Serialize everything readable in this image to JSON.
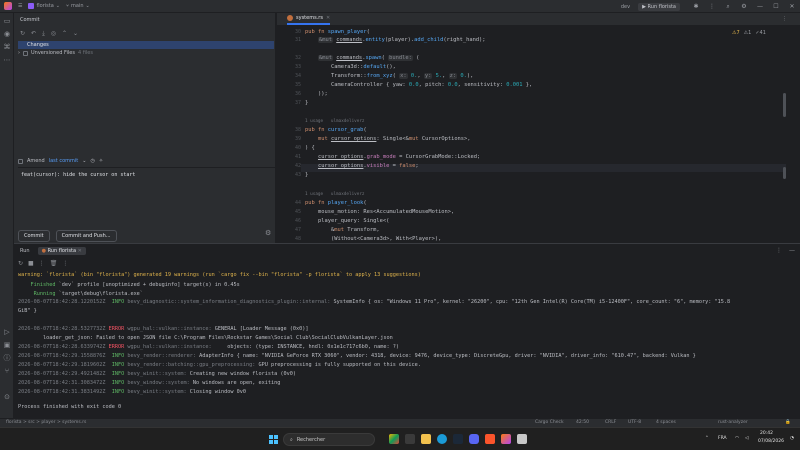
{
  "titlebar": {
    "project": "florista",
    "branch": "main",
    "run_config": "Run florista",
    "config_label": "dev"
  },
  "commit_panel": {
    "title": "Commit",
    "changes_label": "Changes",
    "unversioned_label": "Unversioned Files",
    "unversioned_count": "4 files",
    "amend_label": "Amend",
    "last_commit_link": "last commit",
    "message": "feat(cursor): hide the cursor on start",
    "commit_button": "Commit",
    "commit_push_button": "Commit and Push..."
  },
  "editor": {
    "tab_name": "systems.rs",
    "warnings": "7",
    "weak_warnings": "1",
    "hints": "41",
    "usage_1": "1 usage",
    "author_1": "ulmaxdeliverz",
    "usage_2": "1 usage",
    "author_2": "ulmaxdeliverz",
    "line_numbers": [
      "30",
      "31",
      "32",
      "33",
      "34",
      "35",
      "36",
      "37",
      "38",
      "39",
      "40",
      "41",
      "42",
      "43",
      "44",
      "45",
      "46",
      "47",
      "48"
    ]
  },
  "run_panel": {
    "tab_run": "Run",
    "tab_config": "Run florista",
    "lines": [
      {
        "kind": "warning",
        "text": "warning: `florista` (bin \"florista\") generated 19 warnings (run `cargo fix --bin \"florista\" -p florista` to apply 13 suggestions)"
      },
      {
        "kind": "finished",
        "label": "    Finished",
        "text": " `dev` profile [unoptimized + debuginfo] target(s) in 0.45s"
      },
      {
        "kind": "finished",
        "label": "     Running",
        "text": " `target\\debug\\florista.exe`"
      },
      {
        "kind": "info",
        "ts": "2026-08-07T18:42:28.1220152Z",
        "level": "  INFO",
        "mod": " bevy_diagnostic::system_information_diagnostics_plugin::internal:",
        "text": " SystemInfo { os: \"Windows 11 Pro\", kernel: \"26200\", cpu: \"12th Gen Intel(R) Core(TM) i5-12400F\", core_count: \"6\", memory: \"15.8"
      },
      {
        "kind": "plain",
        "text": "GiB\" }"
      },
      {
        "kind": "error",
        "ts": "2026-08-07T18:42:28.5327732Z",
        "level": " ERROR",
        "mod": " wgpu_hal::vulkan::instance:",
        "text": " GENERAL [Loader Message (0x0)]"
      },
      {
        "kind": "plain",
        "text": "        loader_get_json: Failed to open JSON file C:\\Program Files\\Rockstar Games\\Social Club\\SocialClubVulkanLayer.json"
      },
      {
        "kind": "error",
        "ts": "2026-08-07T18:42:28.6339742Z",
        "level": " ERROR",
        "mod": " wgpu_hal::vulkan::instance:",
        "text": "     objects: (type: INSTANCE, hndl: 0x1e1c717c6b0, name: ?)"
      },
      {
        "kind": "info",
        "ts": "2026-08-07T18:42:29.1558876Z",
        "level": "  INFO",
        "mod": " bevy_render::renderer:",
        "text": " AdapterInfo { name: \"NVIDIA GeForce RTX 3060\", vendor: 4318, device: 9476, device_type: DiscreteGpu, driver: \"NVIDIA\", driver_info: \"610.47\", backend: Vulkan }"
      },
      {
        "kind": "info",
        "ts": "2026-08-07T18:42:29.1819602Z",
        "level": "  INFO",
        "mod": " bevy_render::batching::gpu_preprocessing:",
        "text": " GPU preprocessing is fully supported on this device."
      },
      {
        "kind": "info",
        "ts": "2026-08-07T18:42:29.4921482Z",
        "level": "  INFO",
        "mod": " bevy_winit::system:",
        "text": " Creating new window florista (0v0)"
      },
      {
        "kind": "info",
        "ts": "2026-08-07T18:42:31.3083472Z",
        "level": "  INFO",
        "mod": " bevy_window::system:",
        "text": " No windows are open, exiting"
      },
      {
        "kind": "info",
        "ts": "2026-08-07T18:42:31.3831492Z",
        "level": "  INFO",
        "mod": " bevy_winit::system:",
        "text": " Closing window 0v0"
      },
      {
        "kind": "plain",
        "text": ""
      },
      {
        "kind": "plain",
        "text": "Process finished with exit code 0"
      }
    ]
  },
  "statusbar": {
    "path": "florista > src > player > systems.rs",
    "cargo": "Cargo Check",
    "position": "42:50",
    "crlf": "CRLF",
    "encoding": "UTF-8",
    "indent": "4 spaces",
    "analyzer": "rust-analyzer"
  },
  "taskbar": {
    "search_placeholder": "Rechercher",
    "lang": "FRA",
    "time": "20:42",
    "date": "07/08/2026"
  }
}
